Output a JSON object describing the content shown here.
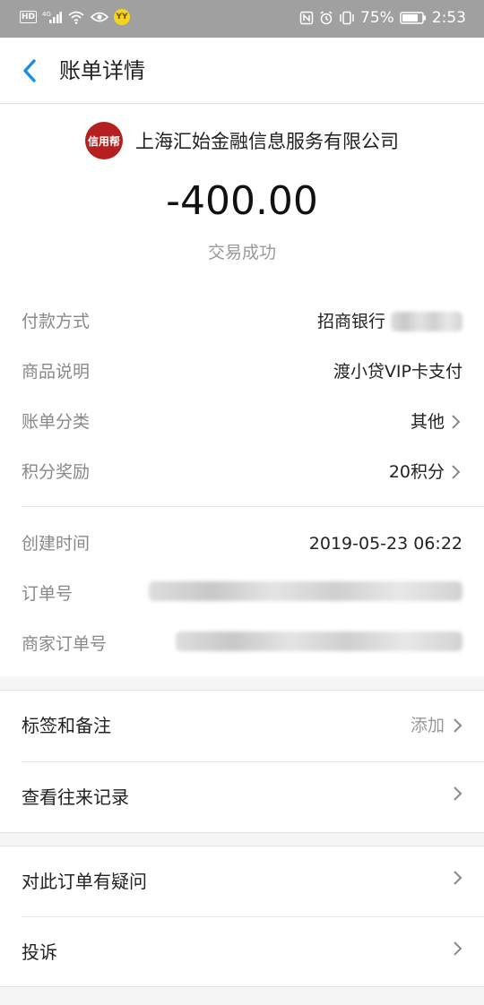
{
  "status_bar": {
    "hd": "HD",
    "network": "4G",
    "yy": "YY",
    "battery": "75%",
    "time": "2:53"
  },
  "header": {
    "title": "账单详情"
  },
  "summary": {
    "merchant_logo_text": "信用帮",
    "merchant_name": "上海汇始金融信息服务有限公司",
    "amount": "-400.00",
    "status": "交易成功"
  },
  "details": [
    {
      "label": "付款方式",
      "value": "招商银行",
      "blurred": true,
      "chevron": true
    },
    {
      "label": "商品说明",
      "value": "渡小贷VIP卡支付",
      "blurred": false,
      "chevron": false
    },
    {
      "label": "账单分类",
      "value": "其他",
      "blurred": false,
      "chevron": true
    },
    {
      "label": "积分奖励",
      "value": "20积分",
      "blurred": false,
      "chevron": true
    }
  ],
  "details2": [
    {
      "label": "创建时间",
      "value": "2019-05-23 06:22"
    },
    {
      "label": "订单号",
      "value": ""
    },
    {
      "label": "商家订单号",
      "value": ""
    }
  ],
  "actions1": [
    {
      "label": "标签和备注",
      "right": "添加"
    },
    {
      "label": "查看往来记录",
      "right": ""
    }
  ],
  "actions2": [
    {
      "label": "对此订单有疑问",
      "right": ""
    },
    {
      "label": "投诉",
      "right": ""
    }
  ],
  "colors": {
    "accent": "#1a8fe0",
    "status_bar": "#a0a0a0",
    "logo": "#b51f1f"
  }
}
